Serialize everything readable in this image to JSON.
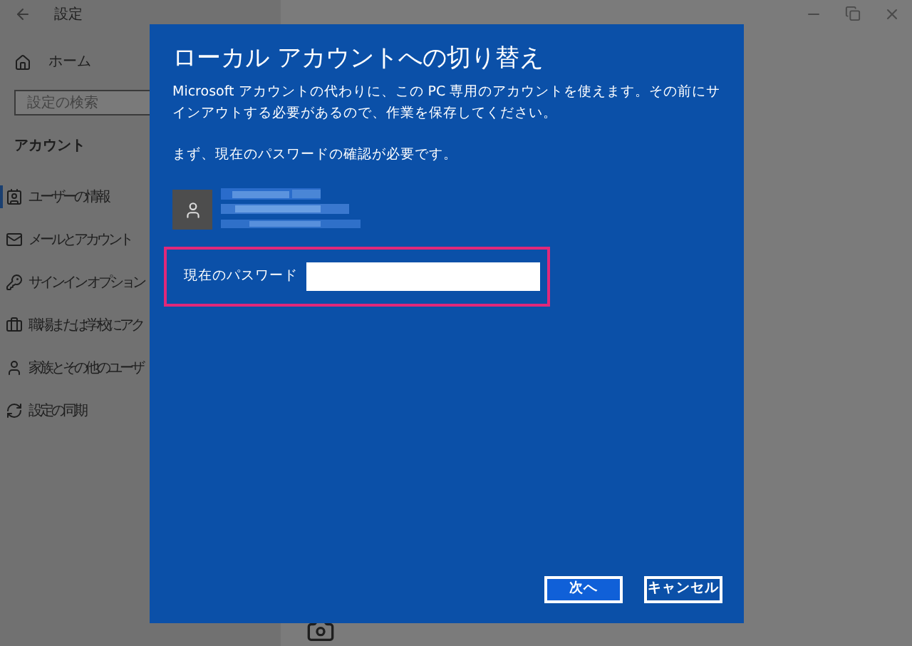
{
  "window": {
    "title": "設定"
  },
  "sidebar": {
    "home": "ホーム",
    "search": {
      "placeholder": "設定の検索"
    },
    "section": "アカウント",
    "items": [
      {
        "label": "ユーザーの情報",
        "kind": "user-info",
        "selected": true
      },
      {
        "label": "メールとアカウント",
        "kind": "mail",
        "selected": false
      },
      {
        "label": "サインイン オプション",
        "kind": "key",
        "selected": false
      },
      {
        "label": "職場または学校にアク",
        "kind": "briefcase",
        "selected": false
      },
      {
        "label": "家族とその他のユーザ",
        "kind": "person",
        "selected": false
      },
      {
        "label": "設定の同期",
        "kind": "sync",
        "selected": false
      }
    ]
  },
  "dialog": {
    "title": "ローカル アカウントへの切り替え",
    "description": "Microsoft アカウントの代わりに、この PC 専用のアカウントを使えます。その前にサインアウトする必要があるので、作業を保存してください。",
    "instruction": "まず、現在のパスワードの確認が必要です。",
    "password": {
      "label": "現在のパスワード",
      "highlighted": true
    },
    "buttons": [
      {
        "label": "次へ",
        "kind": "primary"
      },
      {
        "label": "キャンセル",
        "kind": "secondary"
      }
    ]
  }
}
